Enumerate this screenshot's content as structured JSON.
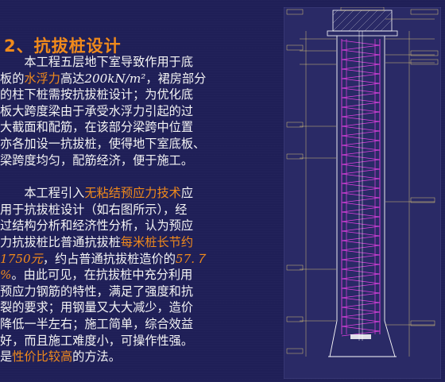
{
  "slide": {
    "title": "2、抗拔桩设计",
    "para1_lines": [
      "　　本工程五层地下室导致作用于底",
      "板的",
      "水浮力",
      "高达",
      "200kN/m²",
      "，裙房部分",
      "的柱下桩需按抗拔桩设计；为优化底",
      "板大跨度梁由于承受水浮力引起的过",
      "大截面和配筋，在该部分梁跨中位置",
      "亦各加设一抗拔桩，使得地下室底板、",
      "梁跨度均匀，配筋经济，便于施工。"
    ],
    "para2": {
      "l1a": "　　本工程引入",
      "l1b": "无粘结预应力技术",
      "l1c": "应",
      "l2": "用于抗拔桩设计（如右图所示），经",
      "l3": "过结构分析和经济性分析，认为预应",
      "l4a": "力抗拔桩比普通抗拔桩",
      "l4b": "每米桩长节约",
      "l5a": "1750元",
      "l5b": "，约占普通抗拔桩造价的",
      "l5c": "57.７",
      "l6a": "%",
      "l6b": "。由此可见，在抗拔桩中充分利用",
      "l7": "预应力钢筋的特性，满足了强度和抗",
      "l8": "裂的要求；用钢量又大大减少，造价",
      "l9": "降低一半左右；施工简单，综合效益",
      "l10": "好，而且施工难度小，可操作性强。",
      "l11a": "是",
      "l11b": "性价比较高",
      "l11c": "的方法。"
    },
    "colors": {
      "background": "#1f1f57",
      "highlight": "#f08a1c",
      "text": "#f4f4f4",
      "drawing_magenta": "#e040e0",
      "drawing_lines": "#ffffff",
      "drawing_labels": "#ffe47a"
    }
  }
}
